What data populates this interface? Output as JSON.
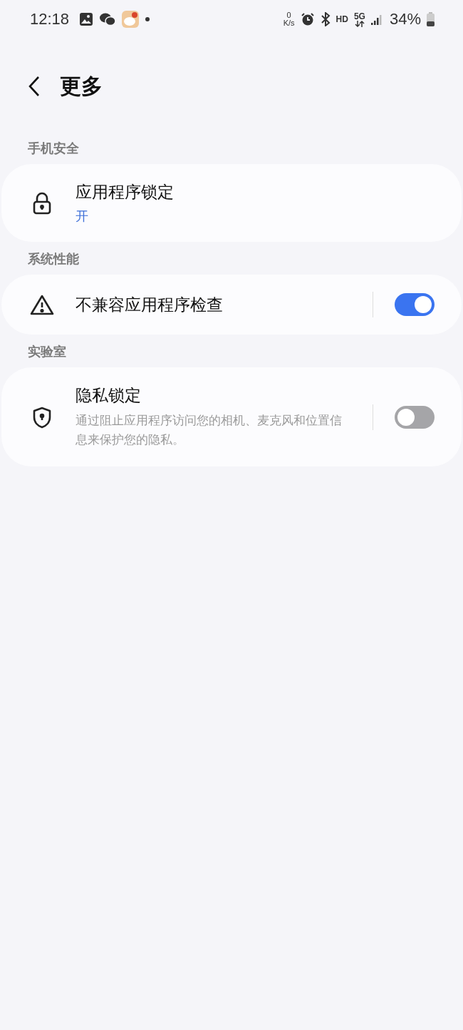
{
  "status_bar": {
    "time": "12:18",
    "net_speed_value": "0",
    "net_speed_unit": "K/s",
    "network_label": "HD",
    "network_type": "5G",
    "battery": "34%"
  },
  "header": {
    "title": "更多"
  },
  "sections": [
    {
      "title": "手机安全",
      "items": [
        {
          "kind": "link",
          "title": "应用程序锁定",
          "status": "开"
        }
      ]
    },
    {
      "title": "系统性能",
      "items": [
        {
          "kind": "toggle",
          "title": "不兼容应用程序检查",
          "on": true
        }
      ]
    },
    {
      "title": "实验室",
      "items": [
        {
          "kind": "toggle",
          "title": "隐私锁定",
          "description": "通过阻止应用程序访问您的相机、麦克风和位置信息来保护您的隐私。",
          "on": false
        }
      ]
    }
  ]
}
